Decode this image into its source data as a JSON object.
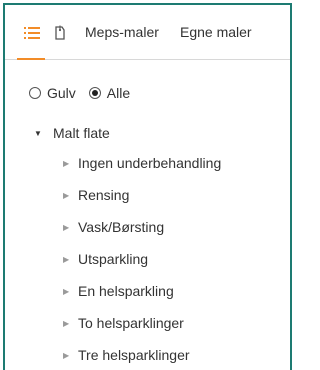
{
  "tabs": {
    "list_icon": "list-icon",
    "tag_icon": "tag-icon",
    "meps": "Meps-maler",
    "egne": "Egne maler",
    "active_color": "#f28c28"
  },
  "filter": {
    "options": [
      {
        "label": "Gulv",
        "checked": false
      },
      {
        "label": "Alle",
        "checked": true
      }
    ]
  },
  "tree": {
    "root": "Malt flate",
    "children": [
      "Ingen underbehandling",
      "Rensing",
      "Vask/Børsting",
      "Utsparkling",
      "En helsparkling",
      "To helsparklinger",
      "Tre helsparklinger"
    ]
  },
  "colors": {
    "border": "#1d7b72",
    "accent": "#f28c28"
  }
}
